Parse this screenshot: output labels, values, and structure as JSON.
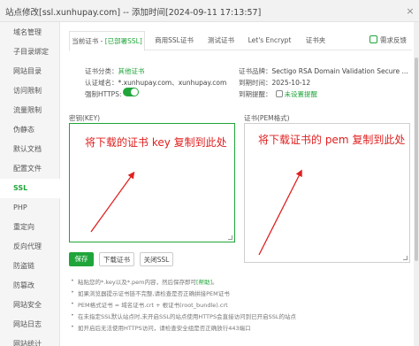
{
  "window": {
    "title": "站点修改[ssl.xunhupay.com] -- 添加时间[2024-09-11 17:13:57]",
    "close_label": "×"
  },
  "sidebar": {
    "items": [
      {
        "label": "域名管理",
        "active": false
      },
      {
        "label": "子目录绑定",
        "active": false
      },
      {
        "label": "网站目录",
        "active": false
      },
      {
        "label": "访问限制",
        "active": false
      },
      {
        "label": "流量限制",
        "active": false
      },
      {
        "label": "伪静态",
        "active": false
      },
      {
        "label": "默认文档",
        "active": false
      },
      {
        "label": "配置文件",
        "active": false
      },
      {
        "label": "SSL",
        "active": true
      },
      {
        "label": "PHP",
        "active": false
      },
      {
        "label": "重定向",
        "active": false
      },
      {
        "label": "反向代理",
        "active": false
      },
      {
        "label": "防盗链",
        "active": false
      },
      {
        "label": "防篡改",
        "active": false
      },
      {
        "label": "网站安全",
        "active": false
      },
      {
        "label": "网站日志",
        "active": false
      },
      {
        "label": "网站统计",
        "active": false
      }
    ]
  },
  "tabs": {
    "current_prefix": "当前证书 - ",
    "current_status": "[已部署SSL]",
    "items": [
      "商用SSL证书",
      "测试证书",
      "Let's Encrypt",
      "证书夹"
    ],
    "feedback": "需求反馈"
  },
  "cert_info": {
    "type_label": "证书分类：",
    "type_value": "其他证书",
    "brand_label": "证书品牌：",
    "brand_value": "Sectigo RSA Domain Validation Secure ...",
    "domains_label": "认证域名：",
    "domains_value": "*.xunhupay.com、xunhupay.com",
    "expiry_label": "到期时间：",
    "expiry_value": "2025-10-12",
    "https_label": "强制HTTPS:",
    "https_enabled": true,
    "reminder_label": "到期提醒：",
    "reminder_value": "未设置提醒"
  },
  "key_box": {
    "label": "密钥(KEY)",
    "annotation": "将下载的证书 key 复制到此处"
  },
  "cert_box": {
    "label": "证书(PEM格式)",
    "annotation": "将下载证书的 pem 复制到此处"
  },
  "buttons": {
    "save": "保存",
    "download": "下载证书",
    "disable": "关闭SSL"
  },
  "tips": {
    "tip1_pre": "粘贴您的*.key以及*.pem内容，然后保存即可",
    "tip1_link": "[帮助]",
    "tip1_post": "。",
    "tip2": "如果浏览器提示证书链不完整,请检查是否正确拼接PEM证书",
    "tip3": "PEM格式证书 = 域名证书.crt + 根证书(root_bundle).crt",
    "tip4": "在未指定SSL默认站点时,未开启SSL的站点使用HTTPS会直接访问到已开启SSL的站点",
    "tip5": "如开启后无法使用HTTPS访问，请检查安全组是否正确放行443端口"
  },
  "colors": {
    "accent": "#20a53a",
    "annotation": "#e02020"
  }
}
